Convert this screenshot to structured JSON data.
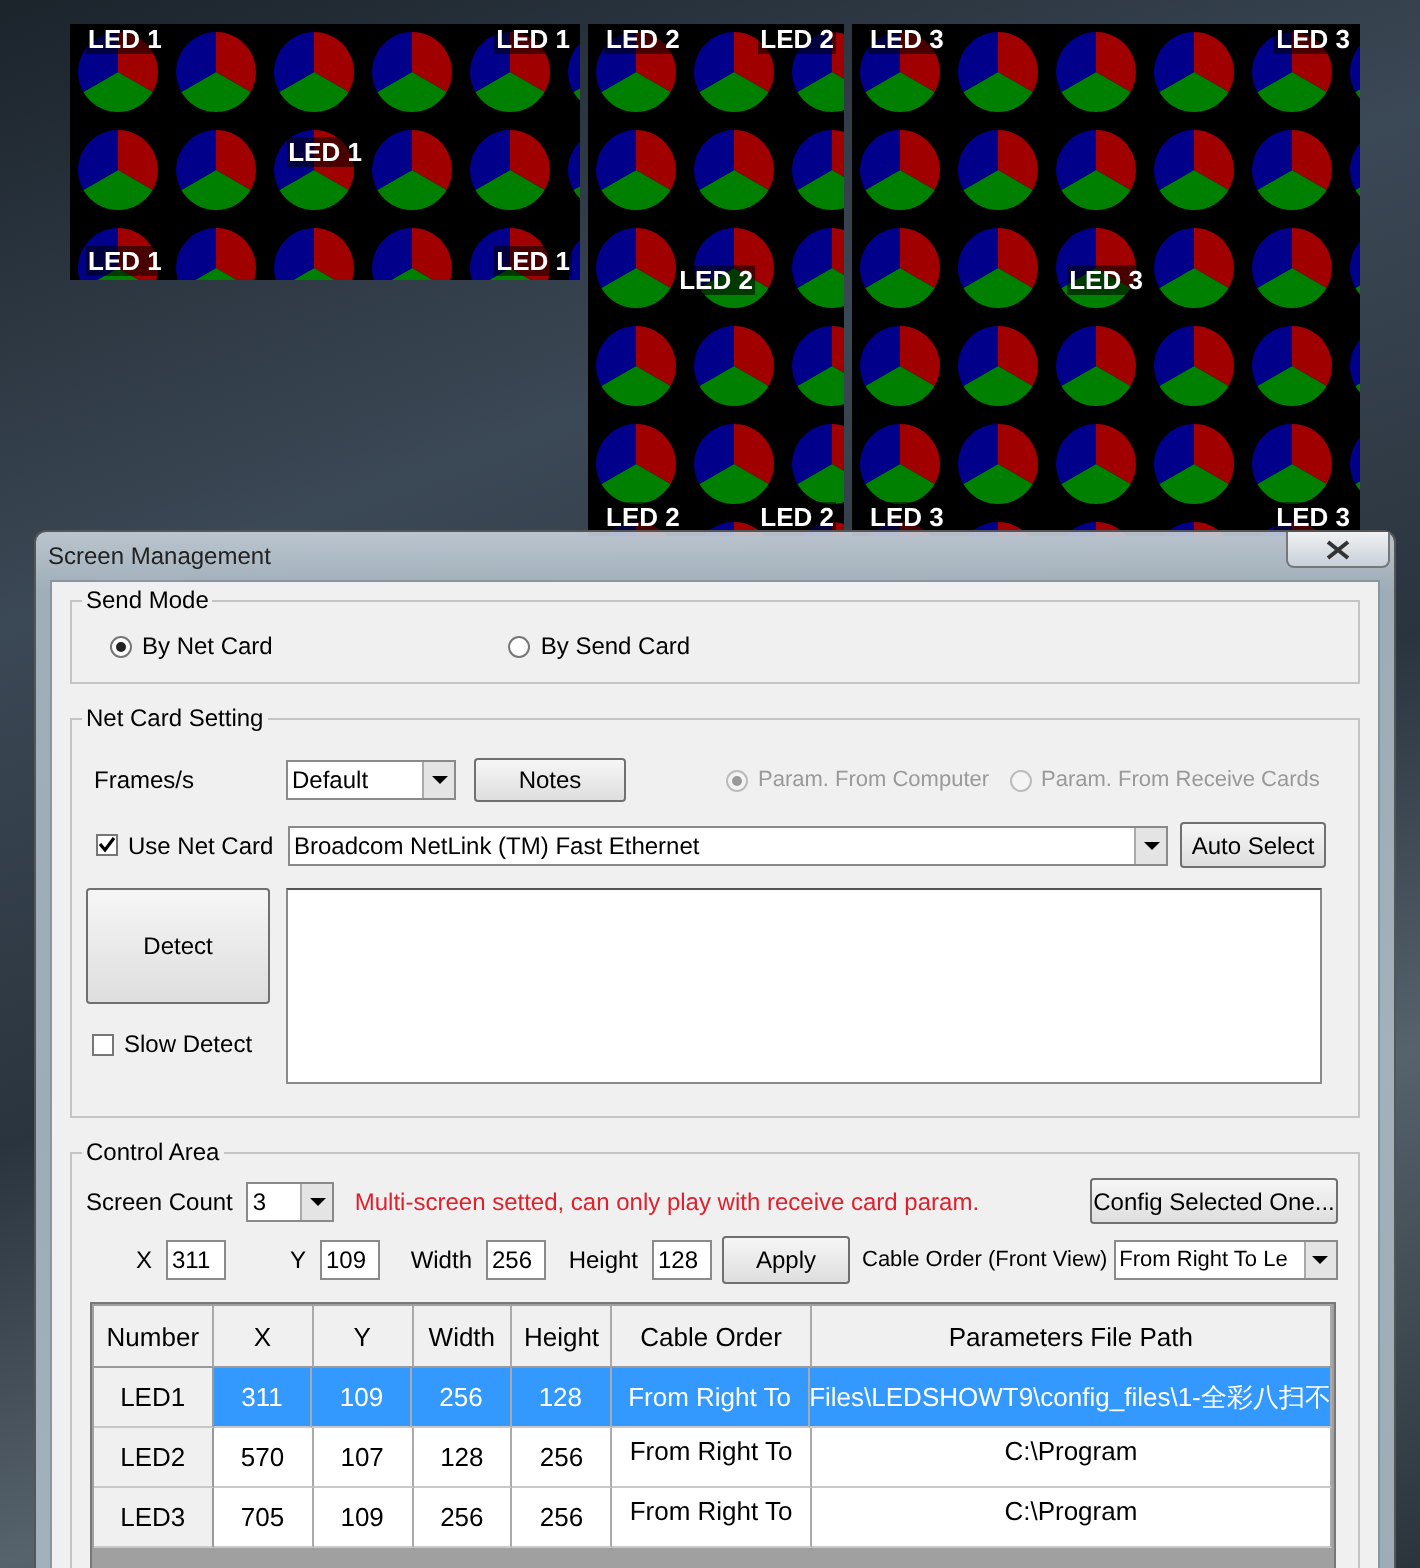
{
  "led_screens": [
    {
      "labels": {
        "top_left": "LED 1",
        "top_right": "LED 1",
        "center": "LED 1",
        "bottom_left": "LED 1",
        "bottom_right": "LED 1"
      }
    },
    {
      "labels": {
        "top_left": "LED 2",
        "top_right": "LED 2",
        "center": "LED 2",
        "bottom_left": "LED 2",
        "bottom_right": "LED 2"
      }
    },
    {
      "labels": {
        "top_left": "LED 3",
        "top_right": "LED 3",
        "center": "LED 3",
        "bottom_left": "LED 3",
        "bottom_right": "LED 3"
      }
    }
  ],
  "window": {
    "title": "Screen Management"
  },
  "send_mode": {
    "title": "Send Mode",
    "options": [
      {
        "label": "By Net Card",
        "selected": true
      },
      {
        "label": "By Send Card",
        "selected": false
      }
    ]
  },
  "net_card_setting": {
    "title": "Net Card Setting",
    "frames_label": "Frames/s",
    "frames_value": "Default",
    "notes_button": "Notes",
    "param_options": [
      {
        "label": "Param. From Computer",
        "selected": true,
        "disabled": true
      },
      {
        "label": "Param. From Receive Cards",
        "selected": false,
        "disabled": true
      }
    ],
    "use_net_card": {
      "label": "Use Net Card",
      "checked": true
    },
    "net_card_value": "Broadcom NetLink (TM) Fast Ethernet",
    "auto_select_button": "Auto Select",
    "detect_button": "Detect",
    "slow_detect": {
      "label": "Slow Detect",
      "checked": false
    }
  },
  "control_area": {
    "title": "Control Area",
    "screen_count_label": "Screen Count",
    "screen_count_value": "3",
    "warning": "Multi-screen setted, can only play with receive card param.",
    "config_button": "Config Selected One...",
    "fields": [
      {
        "label": "X",
        "value": "311"
      },
      {
        "label": "Y",
        "value": "109"
      },
      {
        "label": "Width",
        "value": "256"
      },
      {
        "label": "Height",
        "value": "128"
      }
    ],
    "apply_button": "Apply",
    "cable_order_label": "Cable Order (Front View)",
    "cable_order_value": "From Right To Le"
  },
  "table": {
    "columns": [
      "Number",
      "X",
      "Y",
      "Width",
      "Height",
      "Cable Order",
      "Parameters File Path"
    ],
    "rows": [
      {
        "cells": [
          "LED1",
          "311",
          "109",
          "256",
          "128",
          "From Right To",
          "Files\\LEDSHOWT9\\config_files\\1-全彩八扫不"
        ],
        "selected": true
      },
      {
        "cells": [
          "LED2",
          "570",
          "107",
          "128",
          "256",
          "From Right To",
          "C:\\Program"
        ],
        "selected": false
      },
      {
        "cells": [
          "LED3",
          "705",
          "109",
          "256",
          "256",
          "From Right To",
          "C:\\Program"
        ],
        "selected": false
      }
    ]
  }
}
